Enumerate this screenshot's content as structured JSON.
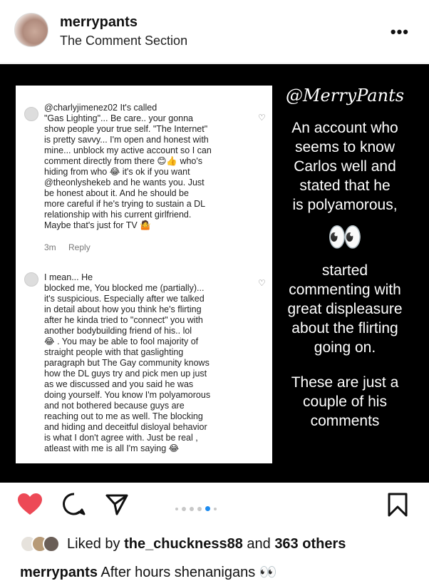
{
  "header": {
    "username": "merrypants",
    "subtitle": "The Comment Section",
    "more_label": "•••"
  },
  "post": {
    "comment1": {
      "text": "@charlyjimenez02 It's called\n\"Gas Lighting\"... Be care.. your gonna\nshow people your true self. \"The Internet\"\nis pretty savvy... I'm open and honest with\nmine... unblock my active account so I can\ncomment directly from there 😊👍 who's\nhiding from who 😂 it's ok if you want\n@theonlyshekeb and he wants you. Just\nbe honest about it. And he should be\nmore careful if he's trying to sustain a DL\nrelationship with his current girlfriend.\nMaybe that's just for TV 🤷",
      "time": "3m",
      "reply": "Reply"
    },
    "comment2": {
      "text": "I mean... He\nblocked me, You blocked me (partially)...\nit's suspicious. Especially after we talked\nin detail about how you think he's flirting\nafter he kinda tried to \"connect\" you with\nanother bodybuilding friend of his.. lol\n😂 . You may be able to fool majority of\nstraight people with that gaslighting\nparagraph but The Gay community knows\nhow the DL guys try and pick men up just\nas we discussed and you said he was\ndoing yourself. You know I'm polyamorous\nand not bothered because guys are\nreaching out to me as well. The blocking\nand hiding and deceitful disloyal behavior\nis what I don't agree with. Just be real ,\natleast with me is all I'm saying 😂"
    },
    "side": {
      "handle": "@MerryPants",
      "text1": "An account who\nseems to know\nCarlos well and\nstated that he\nis polyamorous,",
      "eyes": "👀",
      "text2": "started\ncommenting with\ngreat displeasure\nabout the flirting\ngoing on.",
      "text3": "These are just a\ncouple of his\ncomments"
    }
  },
  "actions": {
    "liked": true,
    "carousel_index": 4,
    "carousel_count": 6
  },
  "likes": {
    "prefix": "Liked by ",
    "user": "the_chuckness88",
    "middle": " and ",
    "others": "363 others"
  },
  "caption": {
    "user": "merrypants",
    "text": " After hours shenanigans 👀"
  },
  "colors": {
    "like_red": "#ed4956",
    "carousel_active": "#1e8cf0"
  }
}
